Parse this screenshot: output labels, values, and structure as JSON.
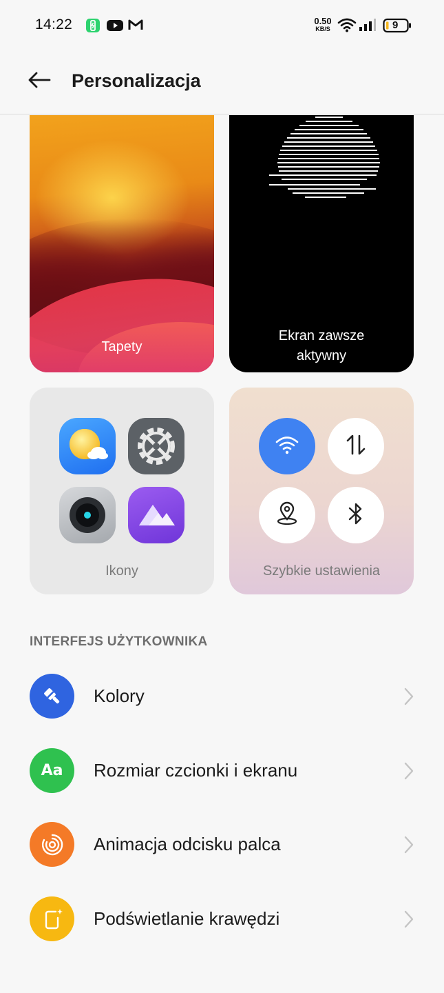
{
  "status_bar": {
    "time": "14:22",
    "net_speed_value": "0.50",
    "net_speed_unit": "KB/S",
    "battery_level": "9",
    "icons": [
      "battery-saver-icon",
      "youtube-icon",
      "gmail-icon",
      "wifi-icon",
      "cellular-signal-icon",
      "battery-icon"
    ]
  },
  "header": {
    "title": "Personalizacja",
    "back_icon": "arrow-left-icon"
  },
  "cards": {
    "wallpaper": {
      "label": "Tapety"
    },
    "aod": {
      "label_line1": "Ekran zawsze",
      "label_line2": "aktywny"
    },
    "icons": {
      "label": "Ikony",
      "apps": [
        "weather-icon",
        "settings-gear-icon",
        "camera-icon",
        "gallery-icon"
      ]
    },
    "quick_settings": {
      "label": "Szybkie ustawienia",
      "toggles": [
        "wifi-icon",
        "mobile-data-icon",
        "location-icon",
        "bluetooth-icon"
      ]
    }
  },
  "section": {
    "title": "INTERFEJS UŻYTKOWNIKA"
  },
  "list": [
    {
      "label": "Kolory",
      "icon": "paint-brush-icon",
      "color": "#2f64e0"
    },
    {
      "label": "Rozmiar czcionki i ekranu",
      "icon": "font-size-icon",
      "color": "#2fc14f",
      "glyph": "Aa"
    },
    {
      "label": "Animacja odcisku palca",
      "icon": "fingerprint-animation-icon",
      "color": "#f47a27"
    },
    {
      "label": "Podświetlanie krawędzi",
      "icon": "edge-lighting-icon",
      "color": "#f7b811"
    }
  ],
  "colors": {
    "accent_blue": "#3f82f2",
    "background": "#f7f7f7"
  }
}
